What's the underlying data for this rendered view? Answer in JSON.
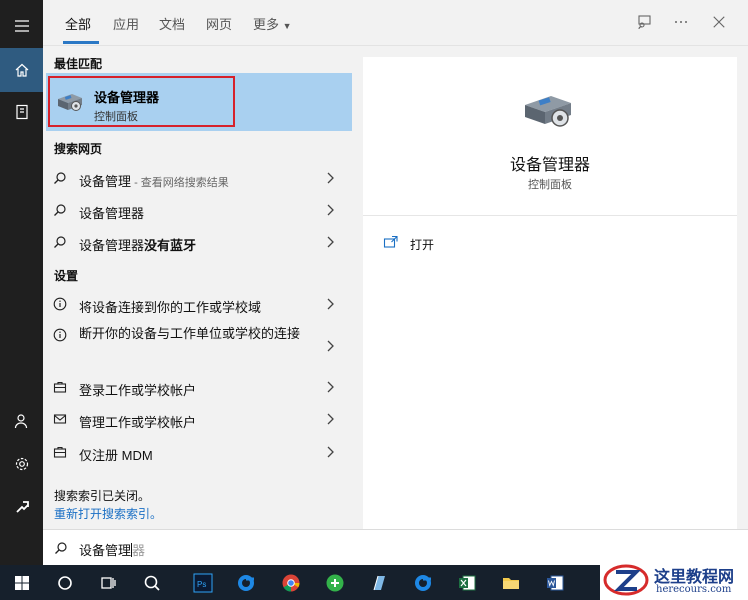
{
  "tabs": [
    {
      "label": "全部"
    },
    {
      "label": "应用"
    },
    {
      "label": "文档"
    },
    {
      "label": "网页"
    },
    {
      "label": "更多"
    }
  ],
  "best_match": {
    "heading": "最佳匹配",
    "title": "设备管理器",
    "subtitle": "控制面板"
  },
  "web": {
    "heading": "搜索网页",
    "items": [
      {
        "query": "设备管理",
        "hint": " - 查看网络搜索结果"
      },
      {
        "query": "设备管理器",
        "hint": ""
      },
      {
        "query_prefix": "设备管理器",
        "query_bold": "没有蓝牙"
      }
    ]
  },
  "settings": {
    "heading": "设置",
    "items": [
      {
        "label": "将设备连接到你的工作或学校域",
        "icon": "info-icon"
      },
      {
        "label": "断开你的设备与工作单位或学校的连接",
        "icon": "info-icon"
      },
      {
        "label": "登录工作或学校帐户",
        "icon": "briefcase-icon"
      },
      {
        "label": "管理工作或学校帐户",
        "icon": "mail-icon"
      },
      {
        "label": "仅注册 MDM",
        "icon": "briefcase-icon"
      }
    ]
  },
  "index": {
    "notice": "搜索索引已关闭。",
    "link": "重新打开搜索索引。"
  },
  "detail": {
    "title": "设备管理器",
    "subtitle": "控制面板",
    "actions": [
      {
        "label": "打开"
      }
    ]
  },
  "search": {
    "typed": "设备管理",
    "ghost": "器"
  },
  "watermark": {
    "name": "这里教程网",
    "url": "herecours.com"
  },
  "colors": {
    "accent": "#2b78c5",
    "selection": "#a9d0f0",
    "highlight_border": "#d6212b",
    "link": "#1a6fc4",
    "taskbar": "#16202c"
  }
}
